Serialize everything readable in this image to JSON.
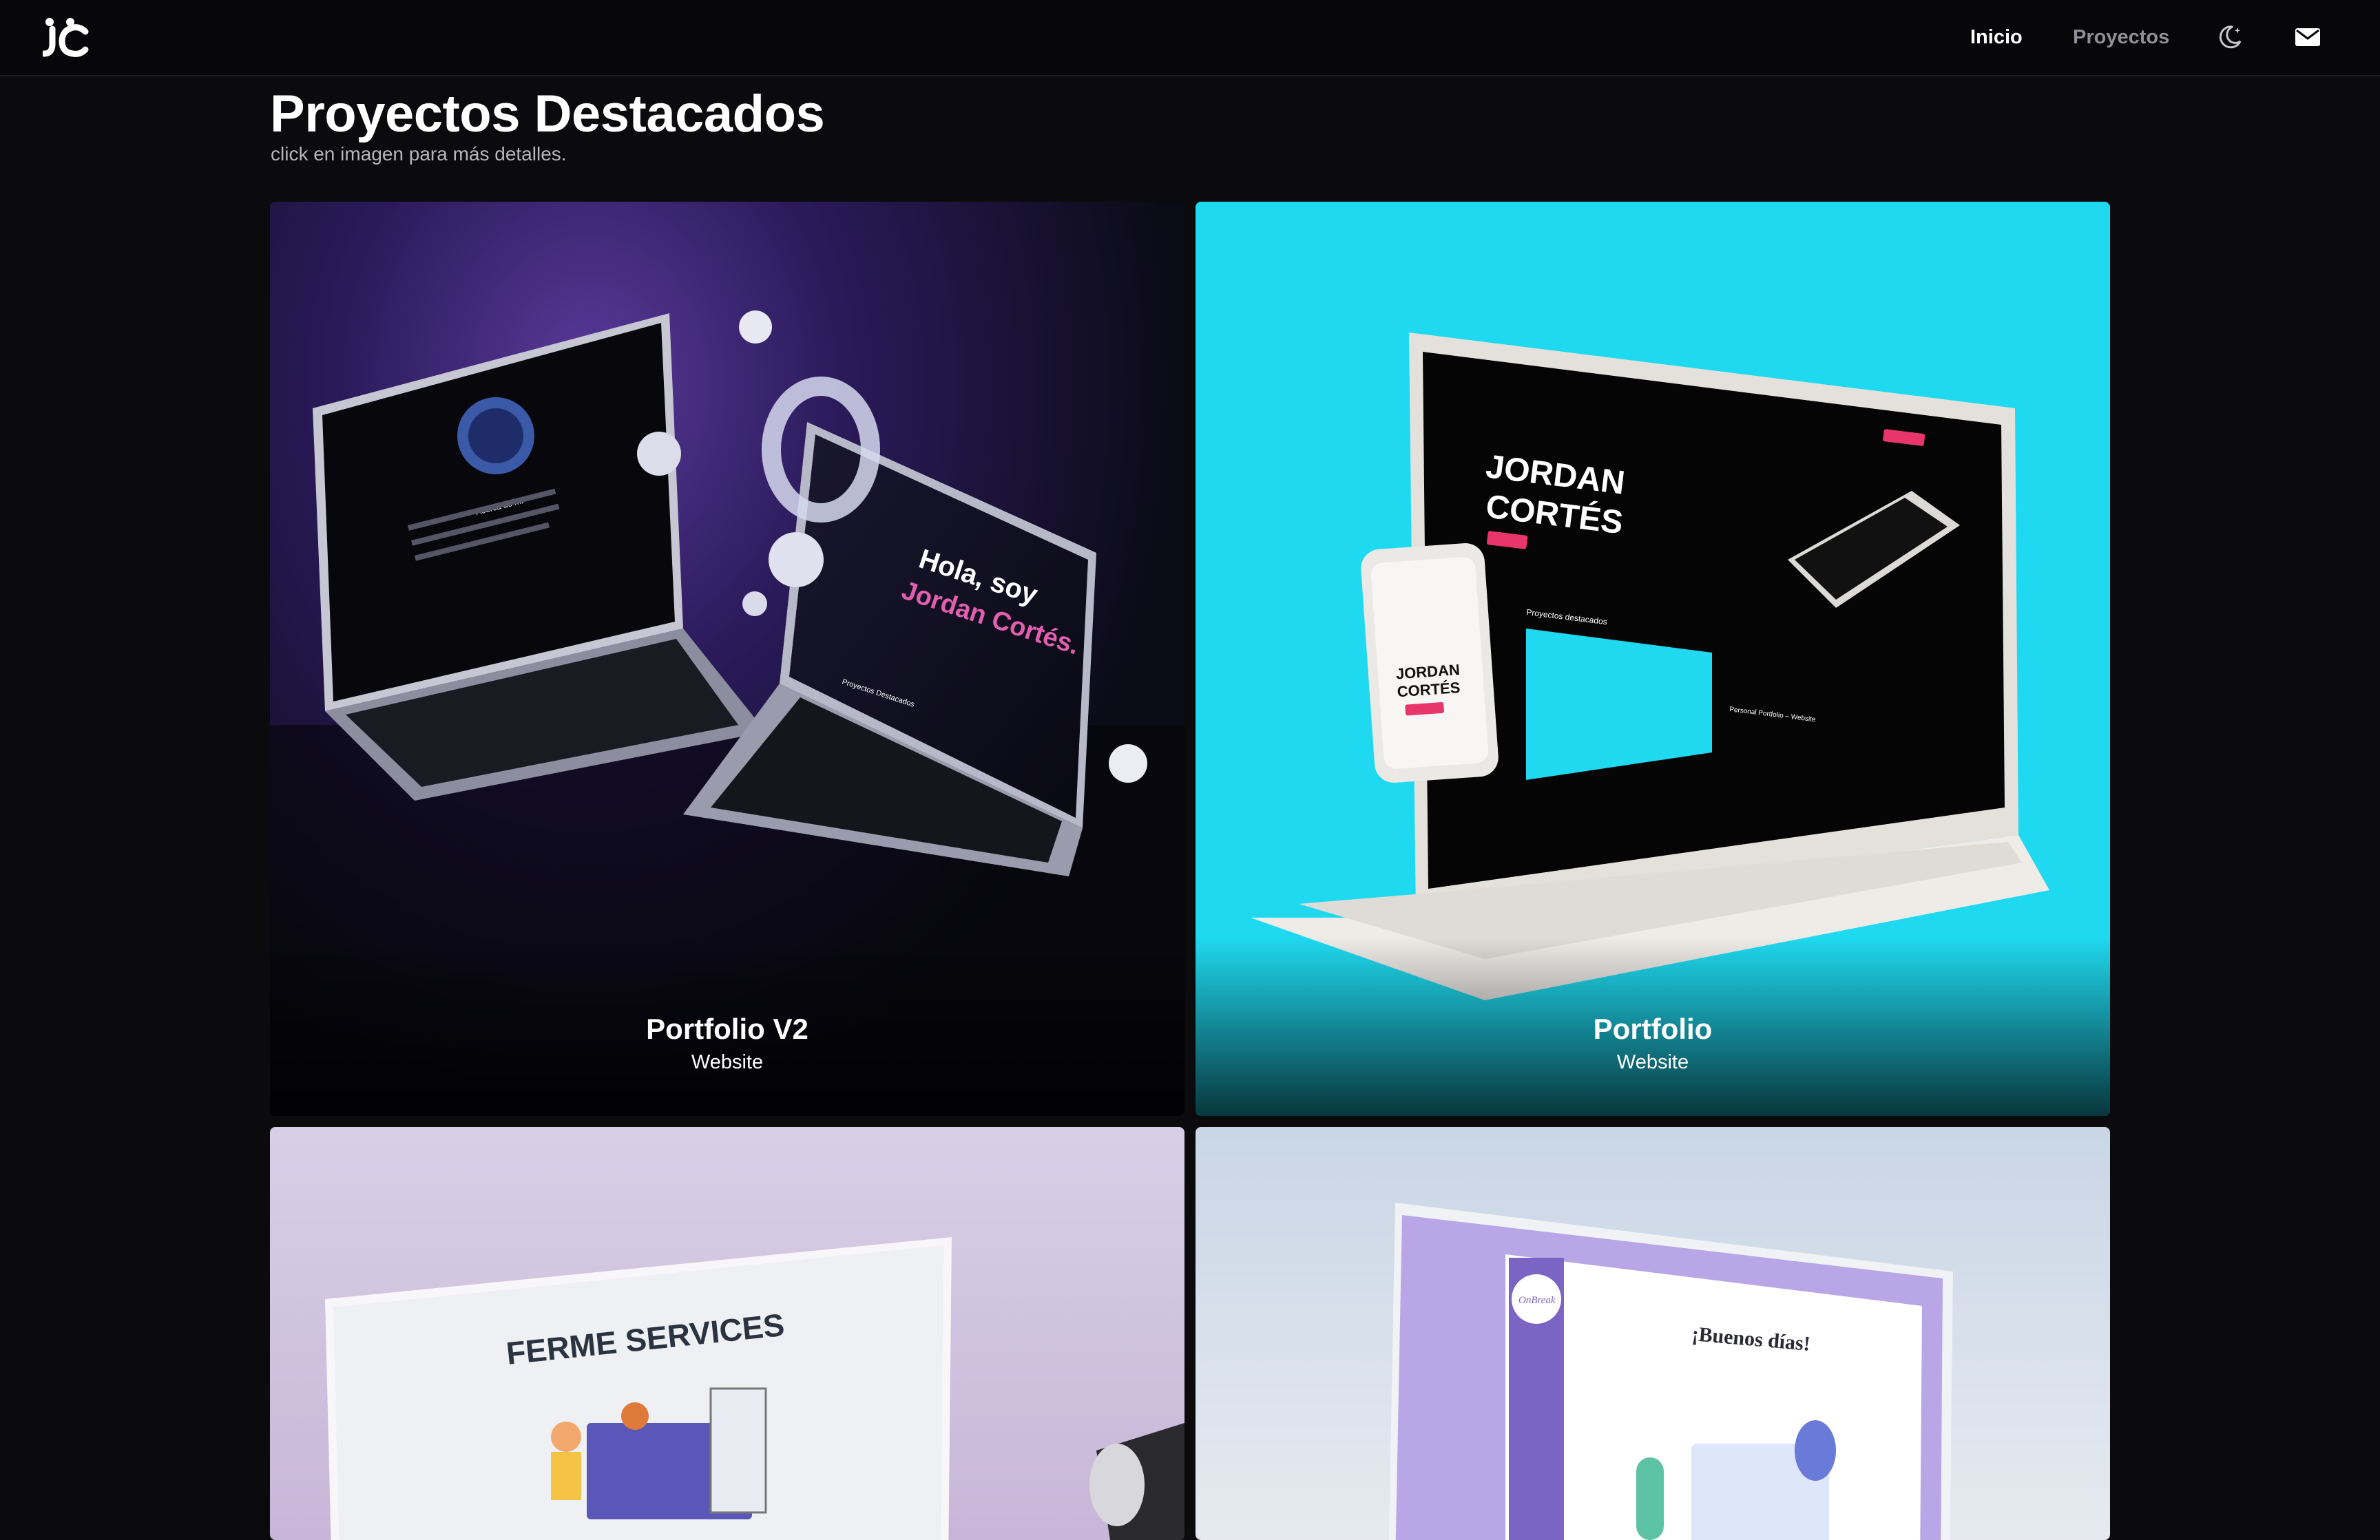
{
  "nav": {
    "logo_text": "JC",
    "links": [
      {
        "label": "Inicio",
        "active": true
      },
      {
        "label": "Proyectos",
        "active": false
      }
    ],
    "icons": [
      "theme-moon-icon",
      "mail-icon"
    ]
  },
  "header": {
    "title": "Proyectos Destacados",
    "subtitle": "click en imagen para más detalles."
  },
  "projects": [
    {
      "title": "Portfolio V2",
      "type": "Website",
      "screen": {
        "heading_1": "Hola, soy",
        "heading_2": "Jordan Cortés.",
        "section": "Proyectos Destacados",
        "about": "Acerca de mí"
      }
    },
    {
      "title": "Portfolio",
      "type": "Website",
      "screen": {
        "hero_1": "JORDAN",
        "hero_2": "CORTÉS",
        "section": "Proyectos destacados",
        "card": "Personal Portfolio – Website"
      }
    },
    {
      "title": "",
      "type": "",
      "screen": {
        "hero": "FERME SERVICES"
      }
    },
    {
      "title": "",
      "type": "",
      "screen": {
        "logo": "OnBreak",
        "greeting": "¡Buenos días!"
      }
    }
  ],
  "colors": {
    "background": "#0b0b0d",
    "nav_background": "#070709",
    "text_muted": "#8f8f96",
    "card_portfolio_bg": "#1fd9f0",
    "accent_pink": "#e8356b",
    "accent_purple": "#6b4bd0"
  }
}
